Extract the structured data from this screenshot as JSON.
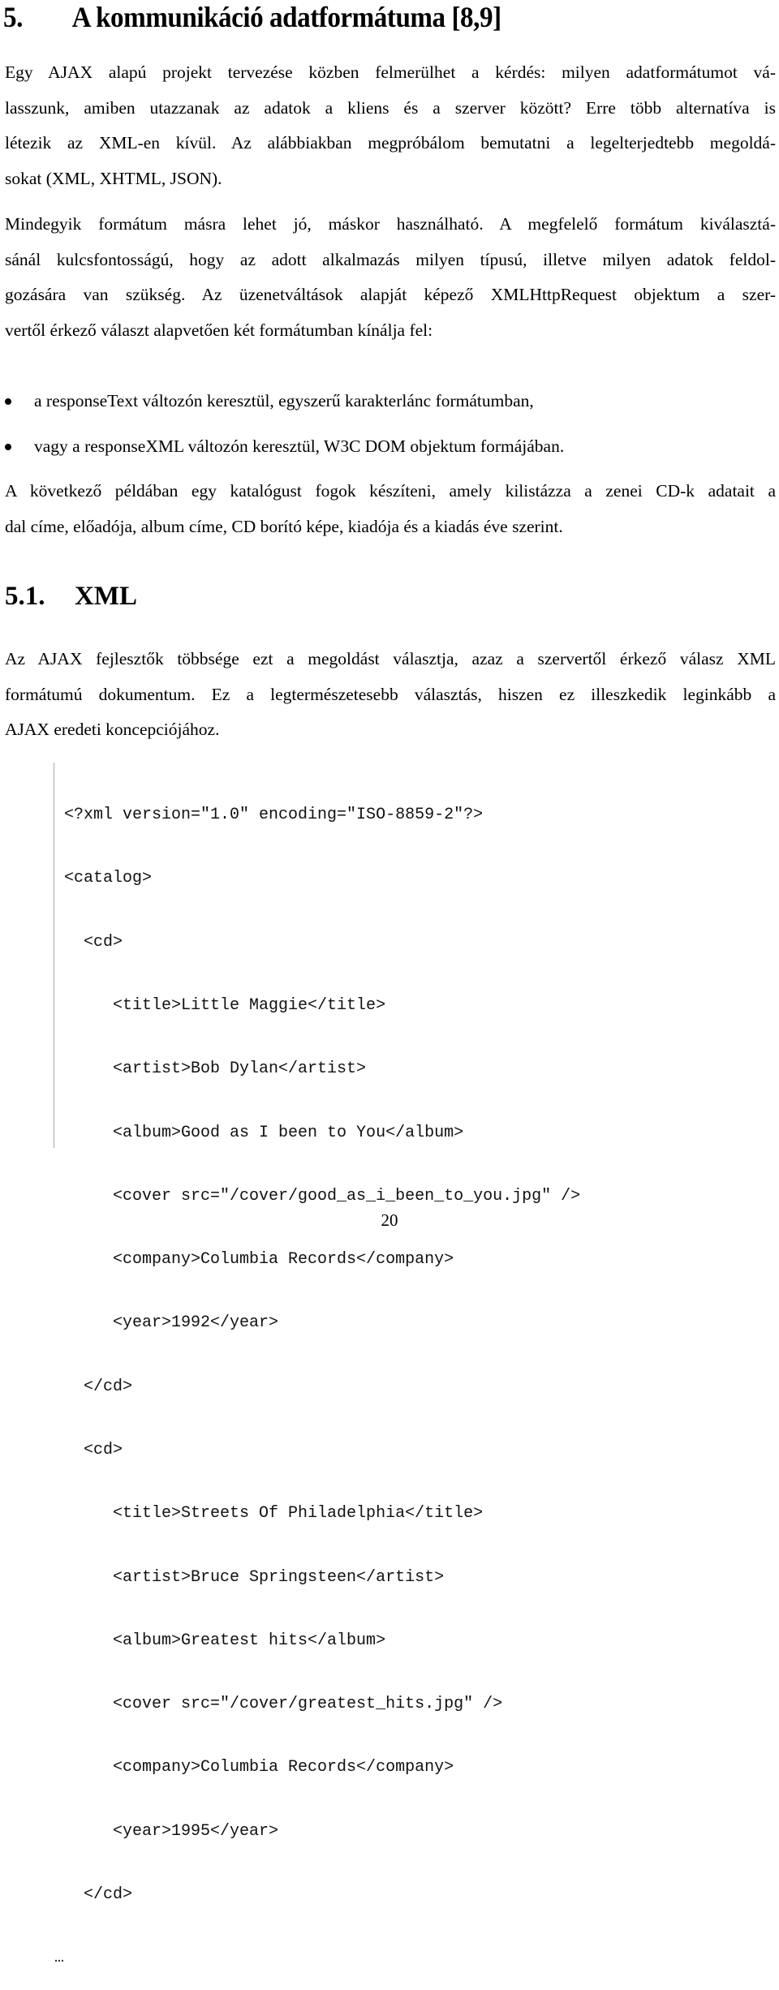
{
  "heading1": {
    "number": "5.",
    "title": "A kommunikáció adatformátuma [8,9]"
  },
  "paragraph1": {
    "lines": [
      "Egy AJAX alapú projekt tervezése közben felmerülhet a kérdés: milyen adatformátumot vá-",
      "lasszunk, amiben utazzanak az adatok a kliens és a szerver között? Erre több alternatíva is",
      "létezik az XML-en kívül. Az alábbiakban megpróbálom bemutatni a legelterjedtebb megoldá-",
      "sokat (XML, XHTML, JSON)."
    ]
  },
  "paragraph2": {
    "lines": [
      "Mindegyik formátum másra lehet jó, máskor használható. A megfelelő formátum kiválasztá-",
      "sánál kulcsfontosságú, hogy az adott alkalmazás milyen típusú, illetve milyen adatok feldol-",
      "gozására van szükség. Az üzenetváltások alapját képező XMLHttpRequest objektum a szer-",
      "vertől érkező választ alapvetően két formátumban kínálja fel:"
    ]
  },
  "bullets": [
    {
      "icon": "bullet-dot",
      "text": "a responseText változón keresztül, egyszerű karakterlánc formátumban,"
    },
    {
      "icon": "bullet-dot",
      "text": "vagy a responseXML változón keresztül, W3C DOM objektum formájában."
    }
  ],
  "paragraph3": {
    "lines": [
      "A következő példában egy katalógust fogok készíteni, amely kilistázza a zenei CD-k adatait a",
      "dal címe, előadója, album címe, CD borító képe, kiadója és a kiadás éve szerint."
    ]
  },
  "heading2": {
    "number": "5.1.",
    "title": "XML"
  },
  "paragraph4": {
    "lines": [
      "Az AJAX fejlesztők többsége ezt a megoldást választja, azaz a szervertől érkező válasz XML",
      "formátumú dokumentum. Ez  a legtermészetesebb választás, hiszen ez illeszkedik leginkább a",
      "AJAX eredeti koncepciójához."
    ]
  },
  "code_block": {
    "lines": [
      "<?xml version=\"1.0\" encoding=\"ISO-8859-2\"?>",
      "<catalog>",
      "  <cd>",
      "     <title>Little Maggie</title>",
      "     <artist>Bob Dylan</artist>",
      "     <album>Good as I been to You</album>",
      "     <cover src=\"/cover/good_as_i_been_to_you.jpg\" />",
      "     <company>Columbia Records</company>",
      "     <year>1992</year>",
      "  </cd>",
      "  <cd>",
      "     <title>Streets Of Philadelphia</title>",
      "     <artist>Bruce Springsteen</artist>",
      "     <album>Greatest hits</album>",
      "     <cover src=\"/cover/greatest_hits.jpg\" />",
      "     <company>Columbia Records</company>",
      "     <year>1995</year>",
      "  </cd>",
      "…"
    ]
  },
  "page_number": "20"
}
